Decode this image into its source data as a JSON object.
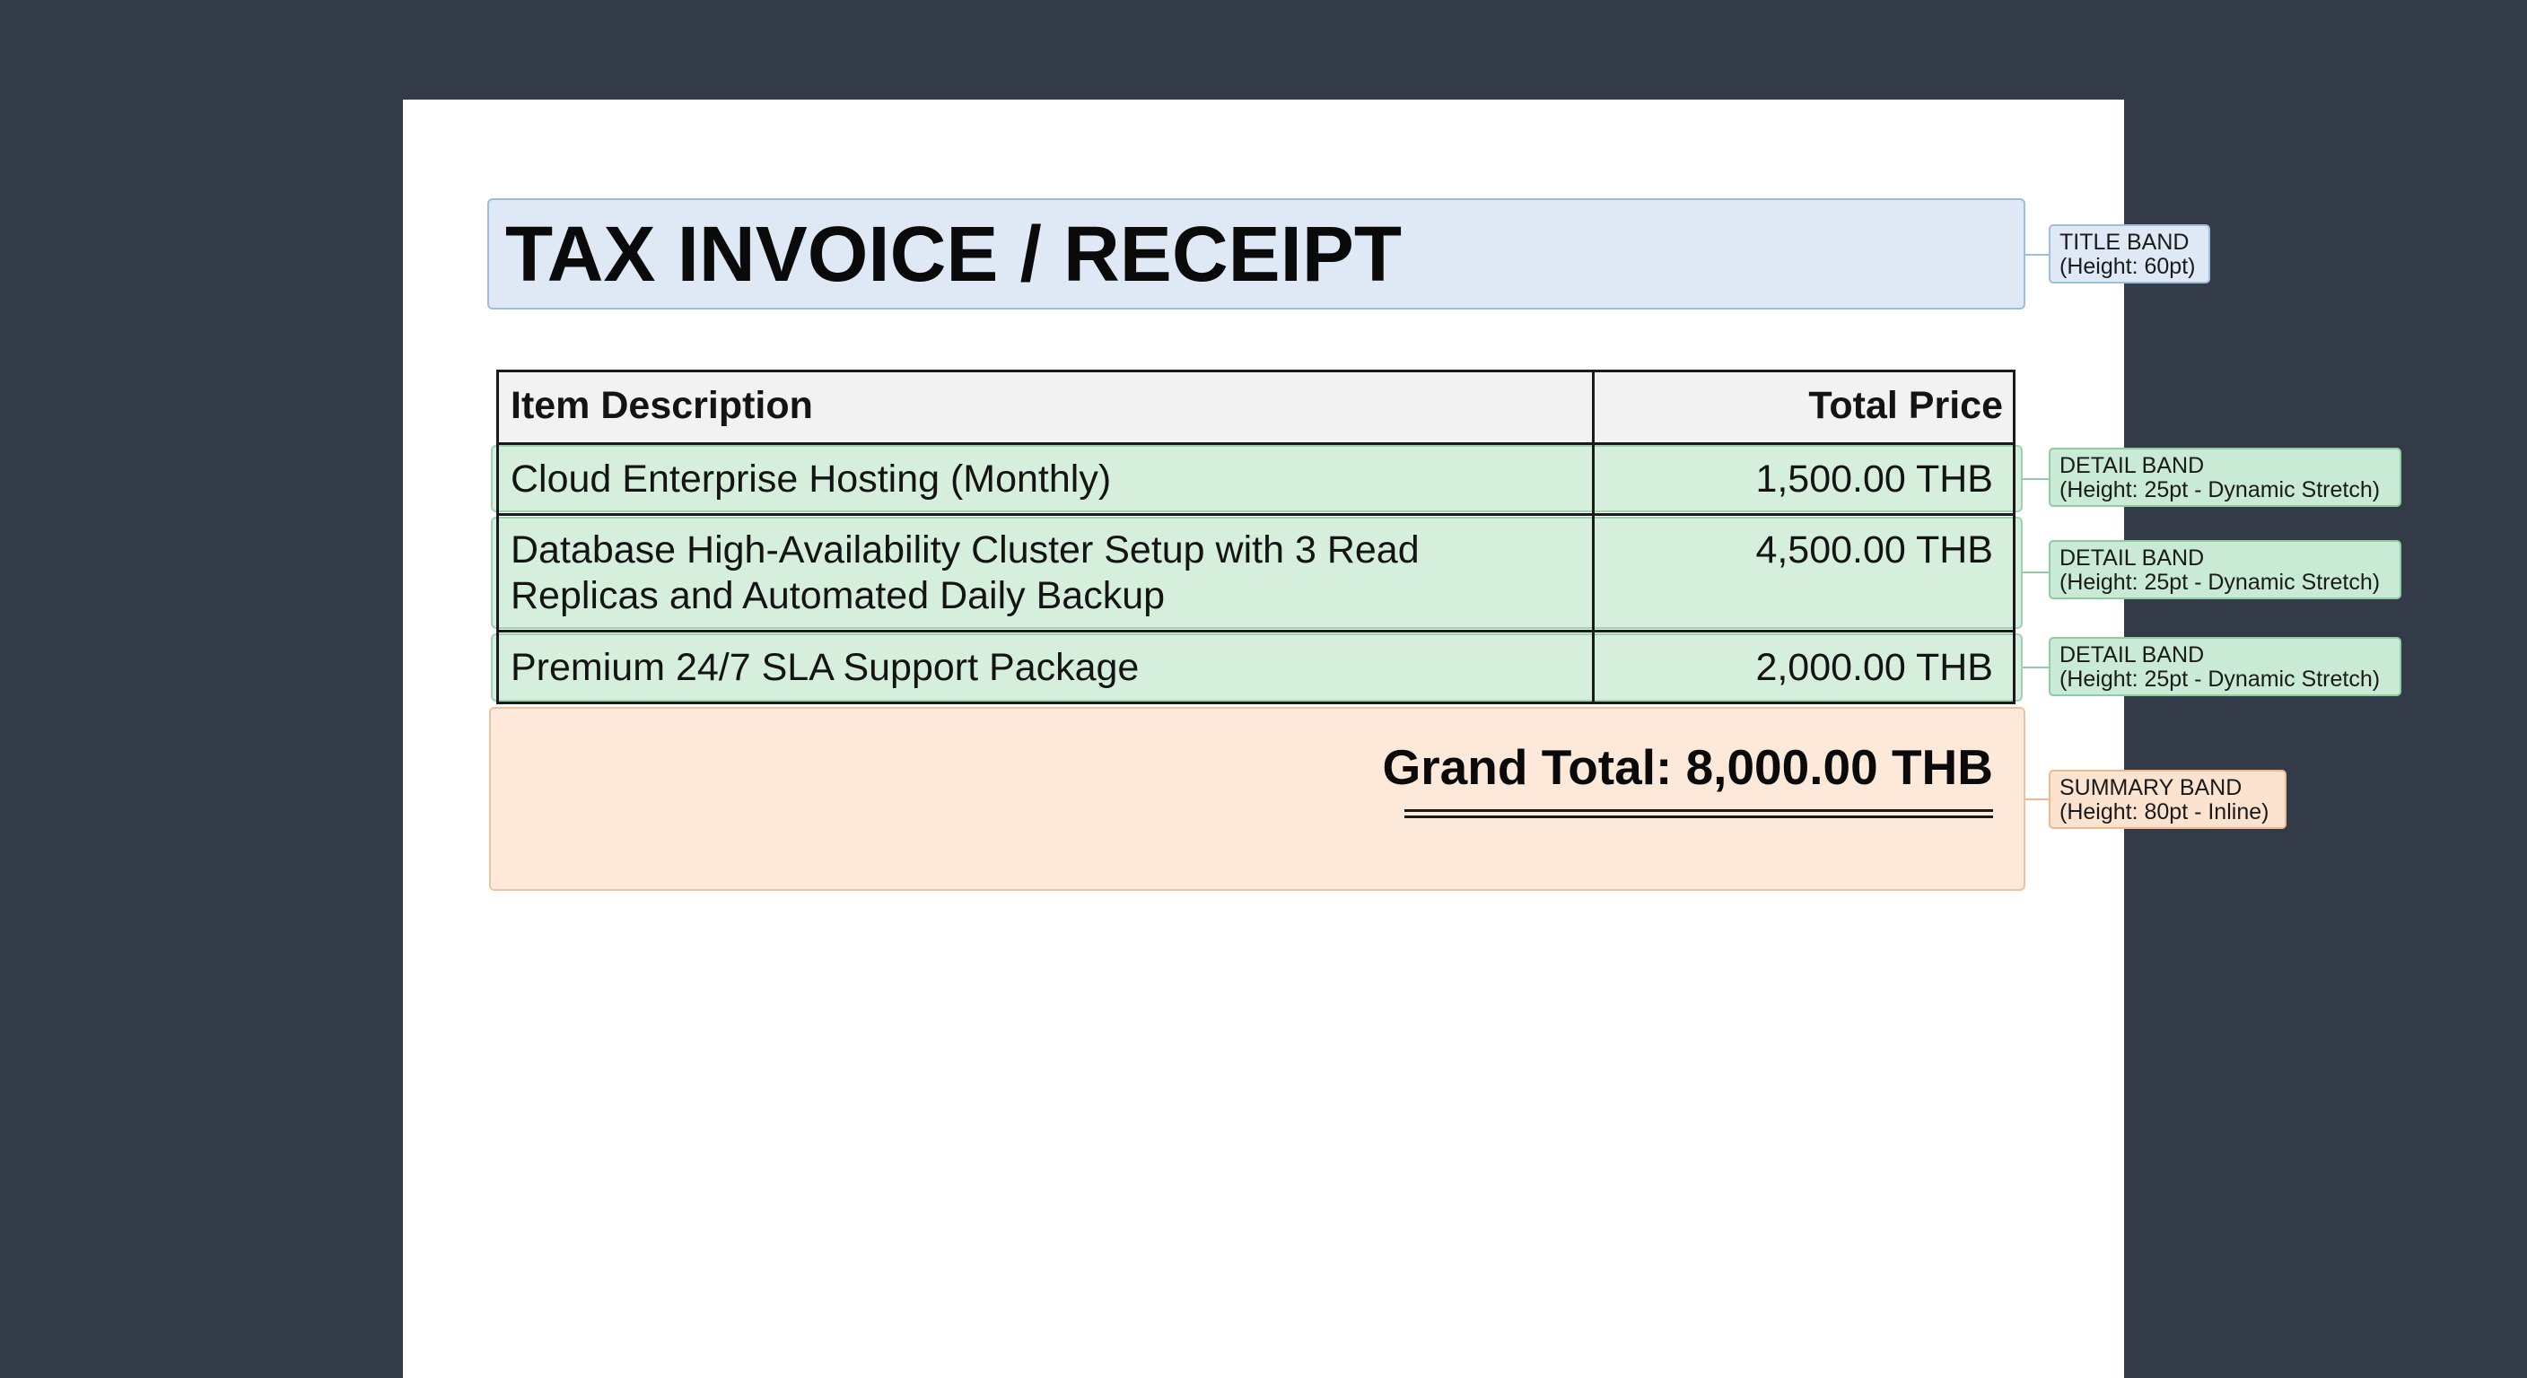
{
  "document": {
    "title": "TAX INVOICE / RECEIPT",
    "table": {
      "columns": [
        "Item Description",
        "Total Price"
      ],
      "rows": [
        {
          "description": "Cloud Enterprise Hosting (Monthly)",
          "price": "1,500.00 THB"
        },
        {
          "description_line1": "Database High-Availability Cluster Setup with 3 Read",
          "description_line2": "Replicas and Automated Daily Backup",
          "price": "4,500.00 THB"
        },
        {
          "description": "Premium 24/7 SLA Support Package",
          "price": "2,000.00 THB"
        }
      ]
    },
    "summary": {
      "grand_total": "Grand Total: 8,000.00 THB"
    }
  },
  "annotations": {
    "title_band": {
      "name": "TITLE BAND",
      "detail": "(Height: 60pt)"
    },
    "detail_band_1": {
      "name": "DETAIL BAND",
      "detail": "(Height: 25pt - Dynamic Stretch)"
    },
    "detail_band_2": {
      "name": "DETAIL BAND",
      "detail": "(Height: 25pt - Dynamic Stretch)"
    },
    "detail_band_3": {
      "name": "DETAIL BAND",
      "detail": "(Height: 25pt - Dynamic Stretch)"
    },
    "summary_band": {
      "name": "SUMMARY BAND",
      "detail": "(Height: 80pt - Inline)"
    }
  },
  "colors": {
    "background": "#323b47",
    "page": "#ffffff",
    "title_band": "#dfe9f6",
    "detail_band": "#c8e9d1",
    "summary_band": "#fce9da"
  }
}
